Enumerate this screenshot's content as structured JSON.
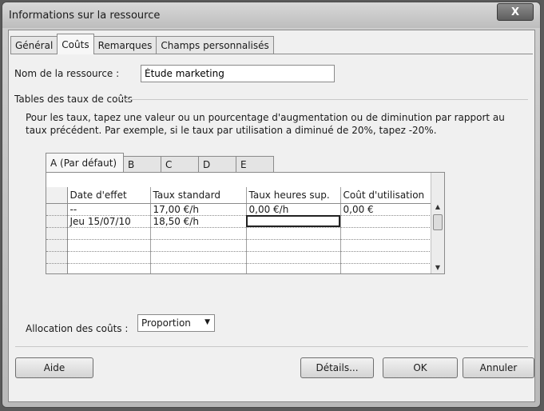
{
  "window": {
    "title": "Informations sur la ressource",
    "close_label": "X"
  },
  "tabs": [
    {
      "label": "Général",
      "active": false
    },
    {
      "label": "Coûts",
      "active": true
    },
    {
      "label": "Remarques",
      "active": false
    },
    {
      "label": "Champs personnalisés",
      "active": false
    }
  ],
  "resource": {
    "name_label": "Nom de la ressource :",
    "name_value": "Étude marketing"
  },
  "cost_tables": {
    "section_label": "Tables des taux de coûts",
    "help_text": "Pour les taux, tapez une valeur ou un pourcentage d'augmentation ou de diminution par rapport au taux précédent. Par exemple, si le taux par utilisation a diminué de 20%, tapez -20%.",
    "rate_tabs": [
      "A (Par défaut)",
      "B",
      "C",
      "D",
      "E"
    ],
    "columns": [
      "Date d'effet",
      "Taux standard",
      "Taux heures sup.",
      "Coût d'utilisation"
    ],
    "rows": [
      [
        "--",
        "17,00 €/h",
        "0,00 €/h",
        "0,00 €"
      ],
      [
        "Jeu 15/07/10",
        "18,50 €/h",
        "",
        ""
      ],
      [
        "",
        "",
        "",
        ""
      ],
      [
        "",
        "",
        "",
        ""
      ],
      [
        "",
        "",
        "",
        ""
      ],
      [
        "",
        "",
        "",
        ""
      ]
    ]
  },
  "allocation": {
    "label": "Allocation des coûts :",
    "value": "Proportion"
  },
  "buttons": {
    "help": "Aide",
    "details": "Détails...",
    "ok": "OK",
    "cancel": "Annuler"
  }
}
